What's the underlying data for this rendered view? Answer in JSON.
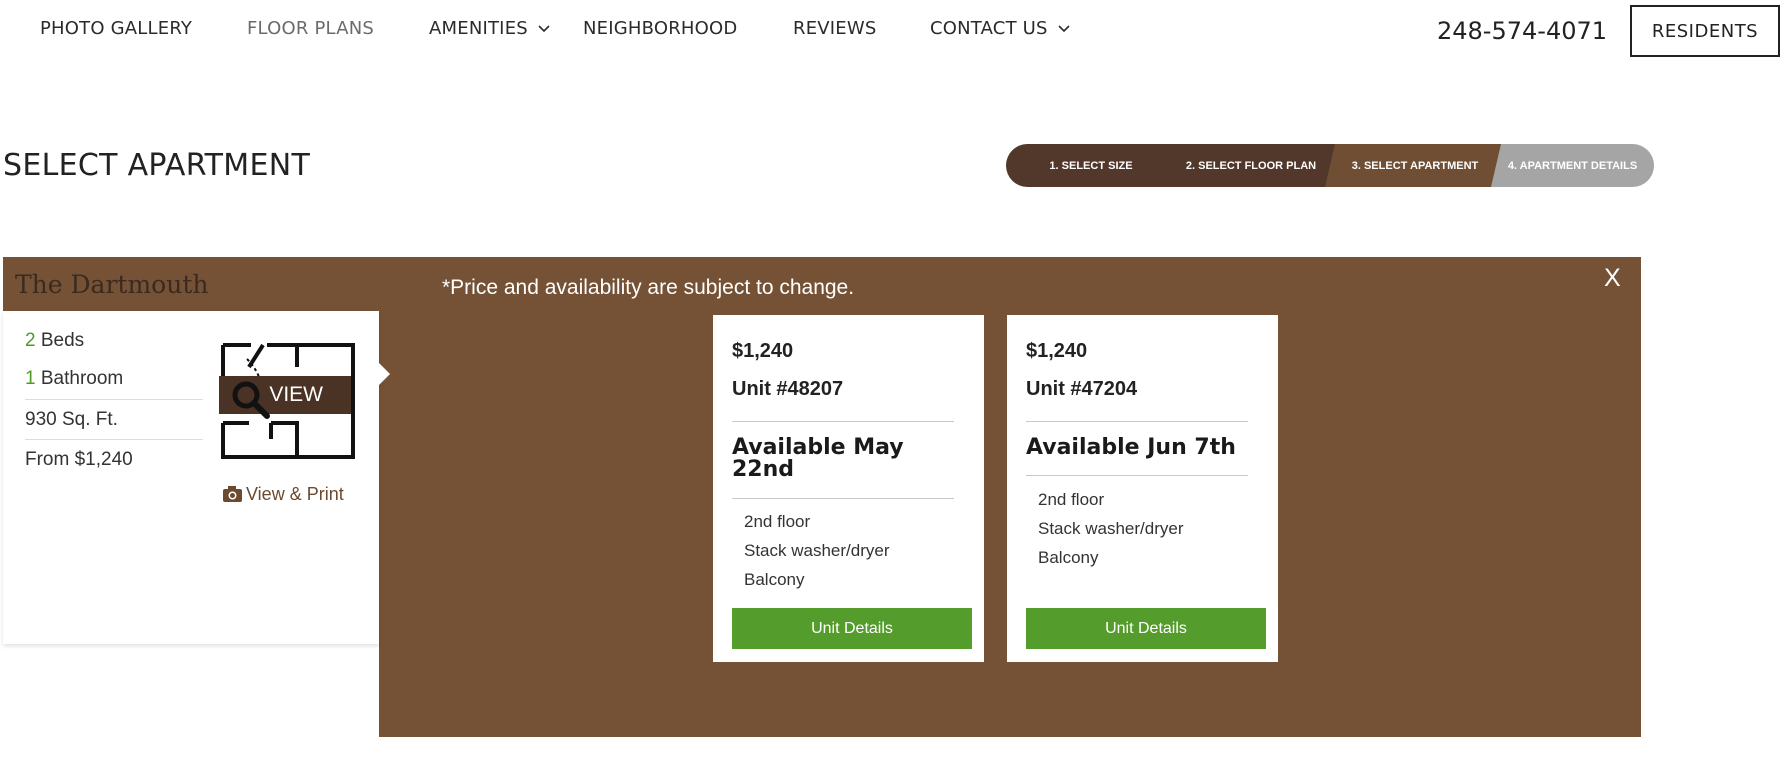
{
  "nav": {
    "items": [
      "PHOTO GALLERY",
      "FLOOR PLANS",
      "AMENITIES",
      "NEIGHBORHOOD",
      "REVIEWS",
      "CONTACT US"
    ],
    "phone": "248-574-4071",
    "residents_label": "RESIDENTS"
  },
  "page_title": "SELECT APARTMENT",
  "steps": [
    "1. SELECT SIZE",
    "2. SELECT FLOOR PLAN",
    "3. SELECT APARTMENT",
    "4. APARTMENT DETAILS"
  ],
  "plan": {
    "name": "The Dartmouth",
    "beds_num": "2",
    "beds_label": "Beds",
    "baths_num": "1",
    "baths_label": "Bathroom",
    "sqft": "930 Sq. Ft.",
    "from_price": "From $1,240",
    "view_label": "VIEW",
    "view_print_label": "View & Print"
  },
  "panel": {
    "disclaimer": "*Price and availability are subject to change.",
    "close_label": "X"
  },
  "units": [
    {
      "price": "$1,240",
      "unit": "Unit #48207",
      "available": "Available May 22nd",
      "features": [
        "2nd floor",
        "Stack washer/dryer",
        "Balcony"
      ],
      "button": "Unit Details"
    },
    {
      "price": "$1,240",
      "unit": "Unit #47204",
      "available": "Available Jun 7th",
      "features": [
        "2nd floor",
        "Stack washer/dryer",
        "Balcony"
      ],
      "button": "Unit Details"
    }
  ],
  "colors": {
    "brand_brown": "#755235",
    "dark_brown": "#52382a",
    "accent_green": "#549c2b",
    "step_inactive": "#a5a5a5"
  }
}
